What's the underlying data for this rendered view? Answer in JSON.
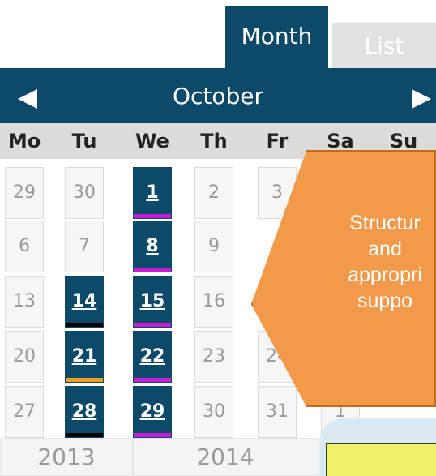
{
  "tabs": {
    "month": "Month",
    "list": "List"
  },
  "header": {
    "month": "October"
  },
  "days_of_week": [
    "Mo",
    "Tu",
    "We",
    "Th",
    "Fr",
    "Sa",
    "Su"
  ],
  "weeks": [
    [
      "29",
      "30",
      "1",
      "2",
      "3",
      "",
      ""
    ],
    [
      "6",
      "7",
      "8",
      "9",
      "",
      "",
      ""
    ],
    [
      "13",
      "14",
      "15",
      "16",
      "",
      "",
      ""
    ],
    [
      "20",
      "21",
      "22",
      "23",
      "24",
      "",
      ""
    ],
    [
      "27",
      "28",
      "29",
      "30",
      "31",
      "1",
      ""
    ]
  ],
  "event_days": [
    "1",
    "8",
    "14",
    "15",
    "21",
    "22",
    "28",
    "29"
  ],
  "years": [
    "2013",
    "2014"
  ],
  "callout": {
    "text": "Structur\nand\nappropri\nsuppo"
  },
  "colors": {
    "navy": "#0d4a6a",
    "orange": "#f29a4a",
    "magenta": "#c41dd6",
    "black": "#000000",
    "gold": "#f0a020"
  }
}
